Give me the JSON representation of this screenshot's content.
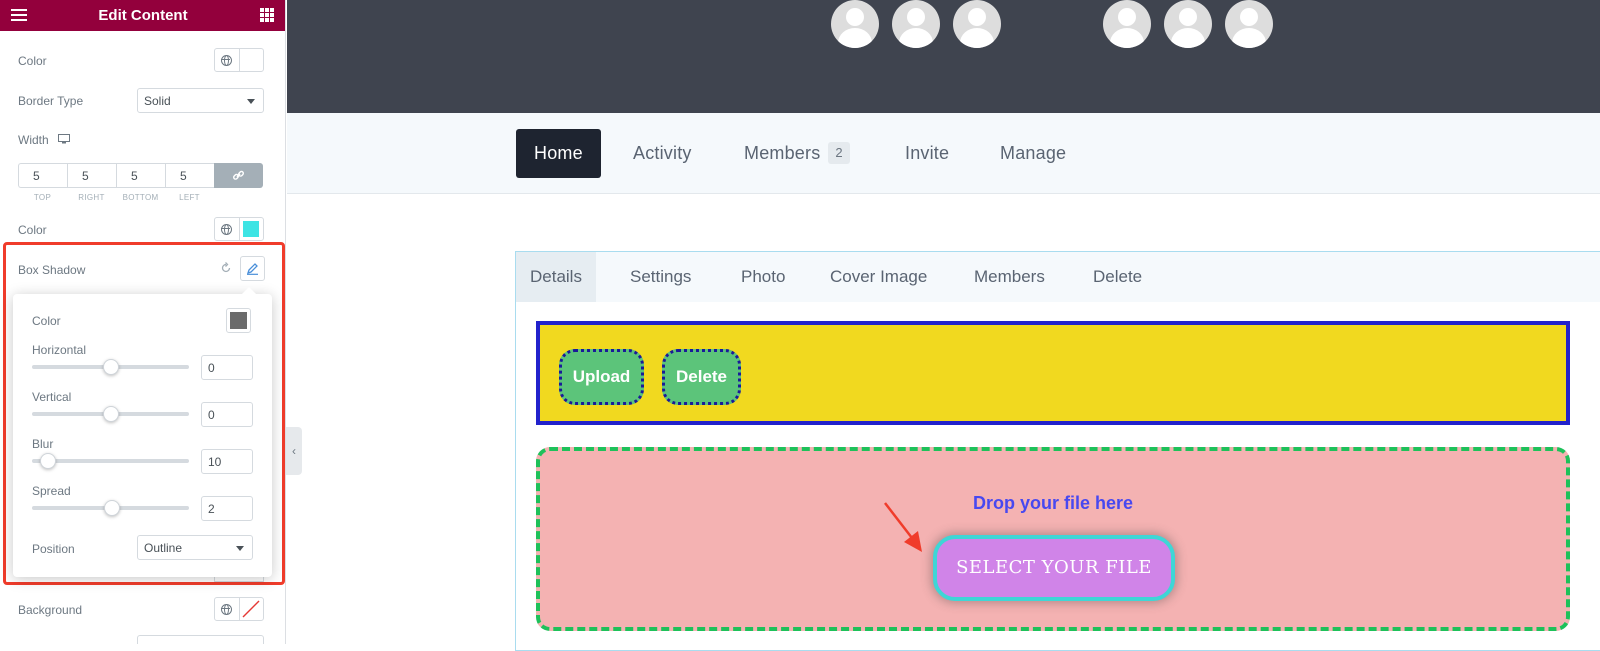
{
  "panel": {
    "title": "Edit Content",
    "color_label": "Color",
    "border_type_label": "Border Type",
    "border_type_value": "Solid",
    "width_label": "Width",
    "dims": [
      {
        "value": "5",
        "label": "TOP"
      },
      {
        "value": "5",
        "label": "RIGHT"
      },
      {
        "value": "5",
        "label": "BOTTOM"
      },
      {
        "value": "5",
        "label": "LEFT"
      }
    ],
    "border_color_label": "Color",
    "border_color": "#3ee4e4",
    "box_shadow_label": "Box Shadow",
    "background_label": "Background"
  },
  "box_shadow": {
    "color_label": "Color",
    "color": "#6b6b6b",
    "horizontal_label": "Horizontal",
    "horizontal_value": "0",
    "horizontal_level": 0.5,
    "vertical_label": "Vertical",
    "vertical_value": "0",
    "vertical_level": 0.5,
    "blur_label": "Blur",
    "blur_value": "10",
    "blur_level": 0.1,
    "spread_label": "Spread",
    "spread_value": "2",
    "spread_level": 0.51,
    "position_label": "Position",
    "position_value": "Outline"
  },
  "nav": {
    "items": [
      "Home",
      "Activity",
      "Members",
      "Invite",
      "Manage"
    ],
    "members_count": "2"
  },
  "subtabs": [
    "Details",
    "Settings",
    "Photo",
    "Cover Image",
    "Members",
    "Delete"
  ],
  "actions": {
    "upload_label": "Upload",
    "delete_label": "Delete"
  },
  "dropzone": {
    "text": "Drop your file here",
    "button_label": "SELECT YOUR FILE"
  },
  "colors": {
    "panel_header": "#93003c",
    "highlight": "#f03c2b",
    "hero": "#3f444f"
  }
}
